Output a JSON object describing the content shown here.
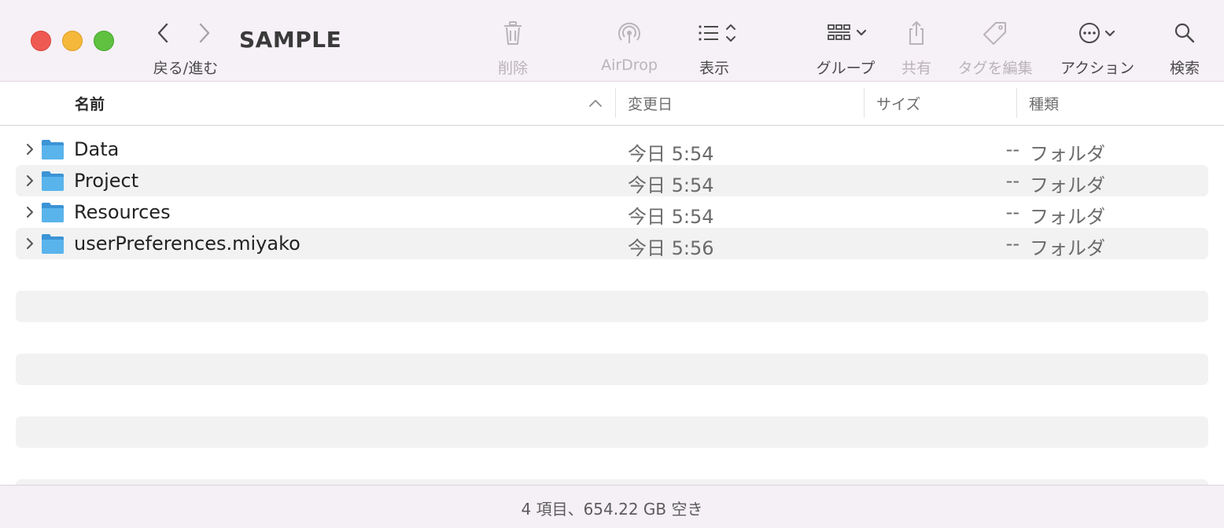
{
  "window": {
    "title": "SAMPLE"
  },
  "toolbar": {
    "nav_label_back": "戻る",
    "nav_label_sep": "/",
    "nav_label_fwd": "進む",
    "delete_label": "削除",
    "airdrop_label": "AirDrop",
    "view_label": "表示",
    "group_label": "グループ",
    "share_label": "共有",
    "tags_label": "タグを編集",
    "action_label": "アクション",
    "search_label": "検索"
  },
  "columns": {
    "name": "名前",
    "modified": "変更日",
    "size": "サイズ",
    "kind": "種類"
  },
  "files": [
    {
      "name": "Data",
      "modified": "今日 5:54",
      "size": "--",
      "kind": "フォルダ"
    },
    {
      "name": "Project",
      "modified": "今日 5:54",
      "size": "--",
      "kind": "フォルダ"
    },
    {
      "name": "Resources",
      "modified": "今日 5:54",
      "size": "--",
      "kind": "フォルダ"
    },
    {
      "name": "userPreferences.miyako",
      "modified": "今日 5:56",
      "size": "--",
      "kind": "フォルダ"
    }
  ],
  "status": {
    "text": "4 項目、654.22 GB 空き"
  },
  "colors": {
    "toolbar_bg": "#f6f0f7",
    "folder_blue": "#4aa6e3",
    "row_alt": "#f1f2f1"
  }
}
